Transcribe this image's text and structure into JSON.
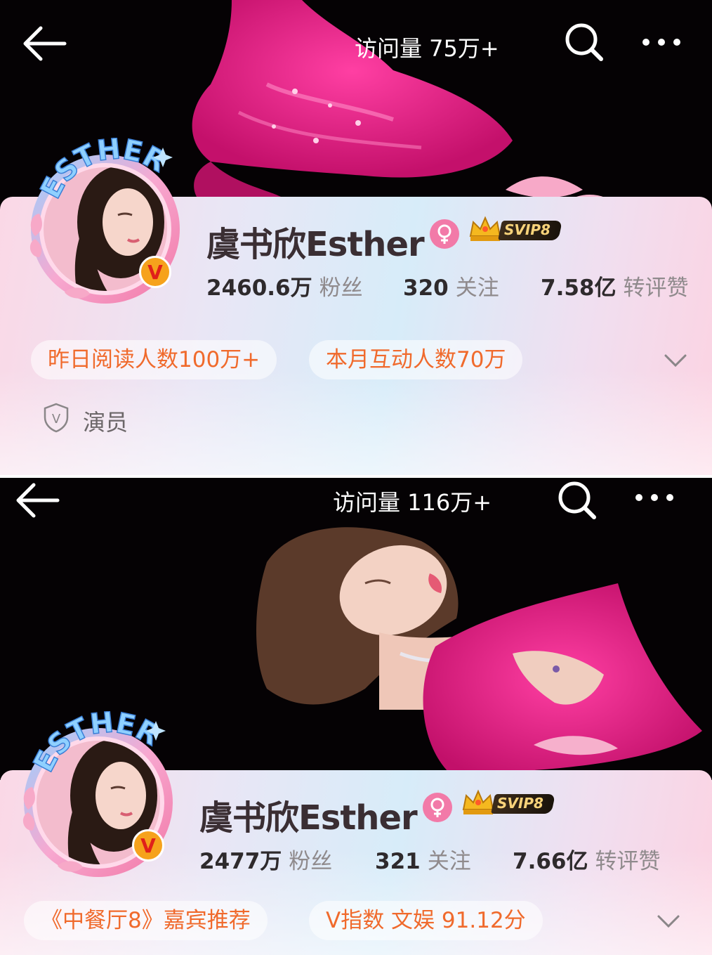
{
  "screens": [
    {
      "visit_count": "访问量 75万+",
      "profile": {
        "avatar_text": "ESTHER",
        "name": "虞书欣Esther",
        "verified_mark": "V",
        "vip_label": "SVIP8",
        "stats": [
          {
            "value": "2460.6万",
            "label": "粉丝"
          },
          {
            "value": "320",
            "label": "关注"
          },
          {
            "value": "7.58亿",
            "label": "转评赞"
          }
        ]
      },
      "pills": [
        "昨日阅读人数100万+",
        "本月互动人数70万"
      ],
      "role": {
        "icon_mark": "V",
        "label": "演员"
      }
    },
    {
      "visit_count": "访问量 116万+",
      "profile": {
        "avatar_text": "ESTHER",
        "name": "虞书欣Esther",
        "verified_mark": "V",
        "vip_label": "SVIP8",
        "stats": [
          {
            "value": "2477万",
            "label": "粉丝"
          },
          {
            "value": "321",
            "label": "关注"
          },
          {
            "value": "7.66亿",
            "label": "转评赞"
          }
        ]
      },
      "pills": [
        "《中餐厅8》嘉宾推荐",
        "V指数 文娱 91.12分"
      ]
    }
  ],
  "colors": {
    "banner_bg": "#050204",
    "dress_pink": "#f0208a",
    "pill_text": "#f06a2c",
    "name_text": "#3a2e33",
    "label_gray": "#8f8a8c",
    "verified_orange": "#f6a21c",
    "verified_red": "#e0201a",
    "vip_gold": "#f8d37a"
  },
  "icons": [
    "back-arrow-icon",
    "search-icon",
    "more-icon",
    "female-icon",
    "crown-icon",
    "verified-badge-icon",
    "chevron-down-icon",
    "shield-icon"
  ]
}
